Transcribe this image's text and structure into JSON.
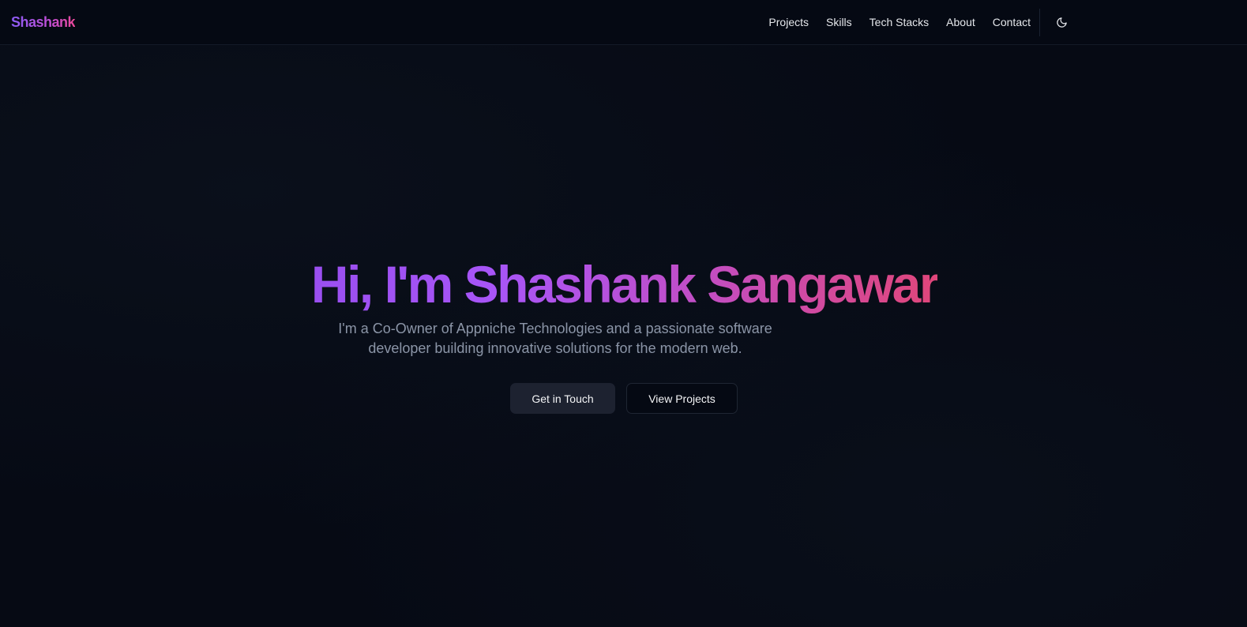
{
  "header": {
    "brand": "Shashank",
    "nav": [
      {
        "label": "Projects"
      },
      {
        "label": "Skills"
      },
      {
        "label": "Tech Stacks"
      },
      {
        "label": "About"
      },
      {
        "label": "Contact"
      }
    ],
    "theme_toggle_icon": "moon-icon"
  },
  "hero": {
    "title": "Hi, I'm Shashank Sangawar",
    "subtitle": "I'm a Co-Owner of Appniche Technologies and a passionate software developer building innovative solutions for the modern web.",
    "primary_button": "Get in Touch",
    "secondary_button": "View Projects"
  },
  "colors": {
    "background": "#060a14",
    "gradient_start": "#a855f7",
    "gradient_end": "#e0467a",
    "subtitle": "#8b95a7"
  }
}
